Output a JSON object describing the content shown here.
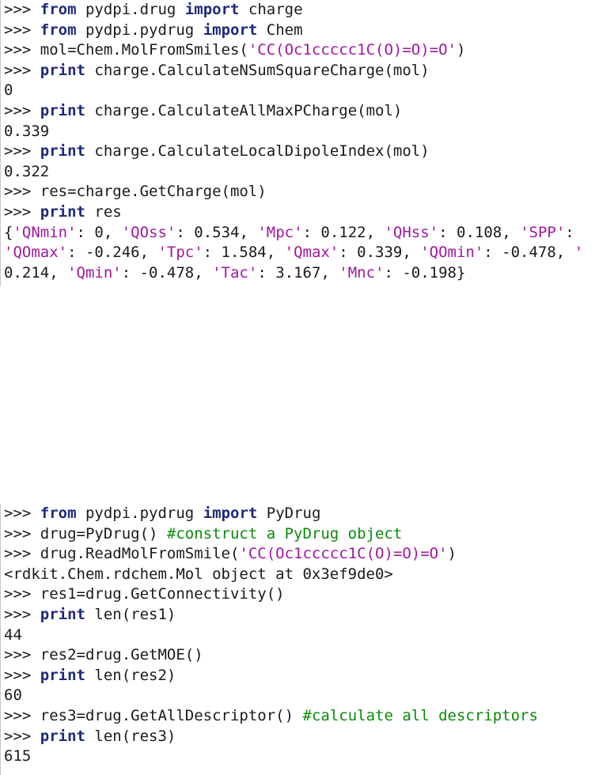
{
  "session1": {
    "lines": [
      [
        {
          "t": "p",
          "v": ">>> "
        },
        {
          "t": "kw",
          "v": "from"
        },
        {
          "t": "p",
          "v": " pydpi.drug "
        },
        {
          "t": "kw",
          "v": "import"
        },
        {
          "t": "p",
          "v": " charge"
        }
      ],
      [
        {
          "t": "p",
          "v": ">>> "
        },
        {
          "t": "kw",
          "v": "from"
        },
        {
          "t": "p",
          "v": " pydpi.pydrug "
        },
        {
          "t": "kw",
          "v": "import"
        },
        {
          "t": "p",
          "v": " Chem"
        }
      ],
      [
        {
          "t": "p",
          "v": ">>> mol=Chem.MolFromSmiles("
        },
        {
          "t": "str",
          "v": "'CC(Oc1ccccc1C(O)=O)=O'"
        },
        {
          "t": "p",
          "v": ")"
        }
      ],
      [
        {
          "t": "p",
          "v": ">>> "
        },
        {
          "t": "kw",
          "v": "print"
        },
        {
          "t": "p",
          "v": " charge.CalculateNSumSquareCharge(mol)"
        }
      ],
      [
        {
          "t": "p",
          "v": "0"
        }
      ],
      [
        {
          "t": "p",
          "v": ">>> "
        },
        {
          "t": "kw",
          "v": "print"
        },
        {
          "t": "p",
          "v": " charge.CalculateAllMaxPCharge(mol)"
        }
      ],
      [
        {
          "t": "p",
          "v": "0.339"
        }
      ],
      [
        {
          "t": "p",
          "v": ">>> "
        },
        {
          "t": "kw",
          "v": "print"
        },
        {
          "t": "p",
          "v": " charge.CalculateLocalDipoleIndex(mol)"
        }
      ],
      [
        {
          "t": "p",
          "v": "0.322"
        }
      ],
      [
        {
          "t": "p",
          "v": ">>> res=charge.GetCharge(mol)"
        }
      ],
      [
        {
          "t": "p",
          "v": ">>> "
        },
        {
          "t": "kw",
          "v": "print"
        },
        {
          "t": "p",
          "v": " res"
        }
      ],
      [
        {
          "t": "p",
          "v": "{"
        },
        {
          "t": "str",
          "v": "'QNmin'"
        },
        {
          "t": "p",
          "v": ": 0, "
        },
        {
          "t": "str",
          "v": "'QOss'"
        },
        {
          "t": "p",
          "v": ": 0.534, "
        },
        {
          "t": "str",
          "v": "'Mpc'"
        },
        {
          "t": "p",
          "v": ": 0.122, "
        },
        {
          "t": "str",
          "v": "'QHss'"
        },
        {
          "t": "p",
          "v": ": 0.108, "
        },
        {
          "t": "str",
          "v": "'SPP'"
        },
        {
          "t": "p",
          "v": ":"
        }
      ],
      [
        {
          "t": "str",
          "v": "'QOmax'"
        },
        {
          "t": "p",
          "v": ": -0.246, "
        },
        {
          "t": "str",
          "v": "'Tpc'"
        },
        {
          "t": "p",
          "v": ": 1.584, "
        },
        {
          "t": "str",
          "v": "'Qmax'"
        },
        {
          "t": "p",
          "v": ": 0.339, "
        },
        {
          "t": "str",
          "v": "'QOmin'"
        },
        {
          "t": "p",
          "v": ": -0.478, "
        },
        {
          "t": "str",
          "v": "'"
        }
      ],
      [
        {
          "t": "p",
          "v": "0.214, "
        },
        {
          "t": "str",
          "v": "'Qmin'"
        },
        {
          "t": "p",
          "v": ": -0.478, "
        },
        {
          "t": "str",
          "v": "'Tac'"
        },
        {
          "t": "p",
          "v": ": 3.167, "
        },
        {
          "t": "str",
          "v": "'Mnc'"
        },
        {
          "t": "p",
          "v": ": -0.198}"
        }
      ]
    ]
  },
  "session2": {
    "lines": [
      [
        {
          "t": "p",
          "v": ">>> "
        },
        {
          "t": "kw",
          "v": "from"
        },
        {
          "t": "p",
          "v": " pydpi.pydrug "
        },
        {
          "t": "kw",
          "v": "import"
        },
        {
          "t": "p",
          "v": " PyDrug"
        }
      ],
      [
        {
          "t": "p",
          "v": ">>> drug=PyDrug() "
        },
        {
          "t": "cm",
          "v": "#construct a PyDrug object"
        }
      ],
      [
        {
          "t": "p",
          "v": ">>> drug.ReadMolFromSmile("
        },
        {
          "t": "str",
          "v": "'CC(Oc1ccccc1C(O)=O)=O'"
        },
        {
          "t": "p",
          "v": ")"
        }
      ],
      [
        {
          "t": "p",
          "v": "<rdkit.Chem.rdchem.Mol object at 0x3ef9de0>"
        }
      ],
      [
        {
          "t": "p",
          "v": ">>> res1=drug.GetConnectivity()"
        }
      ],
      [
        {
          "t": "p",
          "v": ">>> "
        },
        {
          "t": "kw",
          "v": "print"
        },
        {
          "t": "p",
          "v": " len(res1)"
        }
      ],
      [
        {
          "t": "p",
          "v": "44"
        }
      ],
      [
        {
          "t": "p",
          "v": ">>> res2=drug.GetMOE()"
        }
      ],
      [
        {
          "t": "p",
          "v": ">>> "
        },
        {
          "t": "kw",
          "v": "print"
        },
        {
          "t": "p",
          "v": " len(res2)"
        }
      ],
      [
        {
          "t": "p",
          "v": "60"
        }
      ],
      [
        {
          "t": "p",
          "v": ">>> res3=drug.GetAllDescriptor() "
        },
        {
          "t": "cm",
          "v": "#calculate all descriptors"
        }
      ],
      [
        {
          "t": "p",
          "v": ">>> "
        },
        {
          "t": "kw",
          "v": "print"
        },
        {
          "t": "p",
          "v": " len(res3)"
        }
      ],
      [
        {
          "t": "p",
          "v": "615"
        }
      ]
    ]
  }
}
